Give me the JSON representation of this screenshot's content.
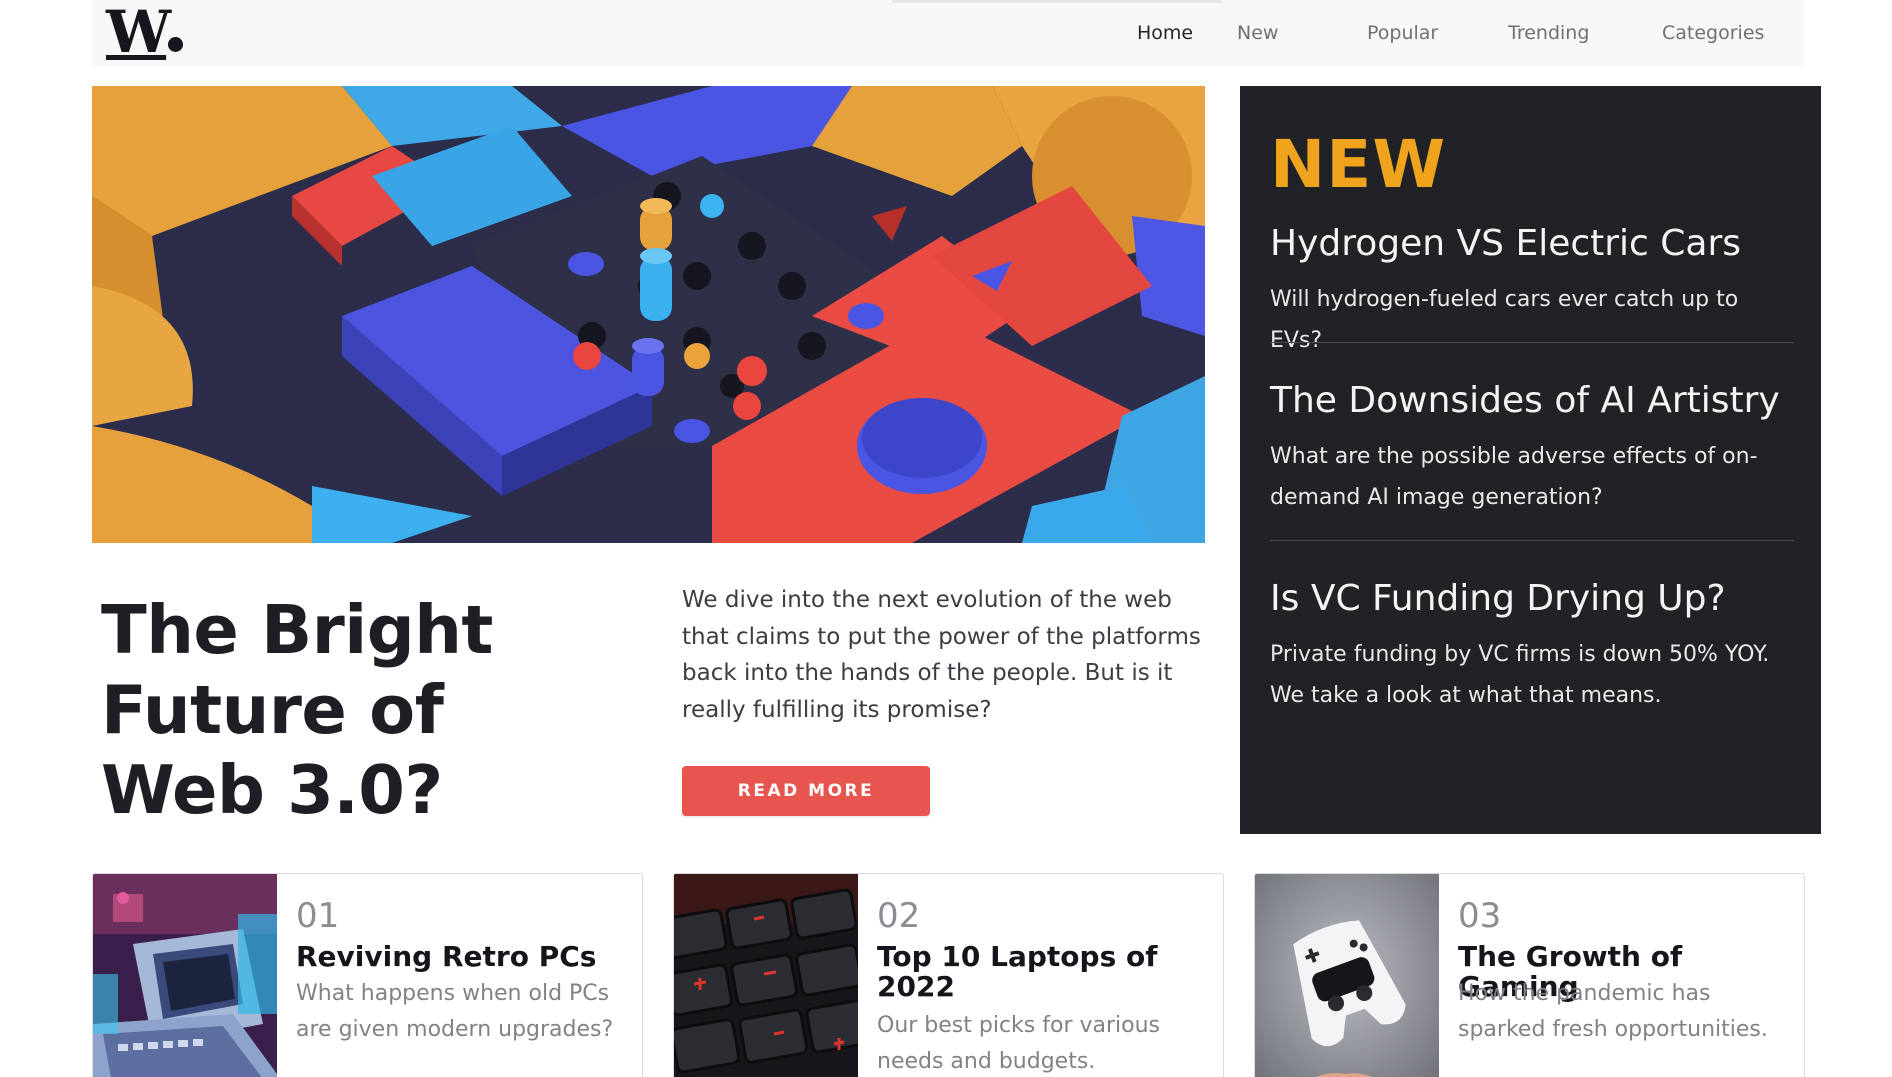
{
  "header": {
    "logo": "W",
    "nav": [
      "Home",
      "New",
      "Popular",
      "Trending",
      "Categories"
    ]
  },
  "hero": {
    "title": "The Bright Future of Web 3.0?",
    "description": "We dive into the next evolution of the web that claims to put the power of the platforms back into the hands of the people. But is it really fulfilling its promise?",
    "read_more_label": "READ MORE"
  },
  "new_panel": {
    "heading": "NEW",
    "items": [
      {
        "title": "Hydrogen VS Electric Cars",
        "desc": "Will hydrogen-fueled cars ever catch up to EVs?"
      },
      {
        "title": "The Downsides of AI Artistry",
        "desc": "What are the possible adverse effects of on-demand AI image generation?"
      },
      {
        "title": "Is VC Funding Drying Up?",
        "desc": "Private funding by VC firms is down 50% YOY. We take a look at what that means."
      }
    ]
  },
  "cards": [
    {
      "number": "01",
      "title": "Reviving Retro PCs",
      "desc": "What happens when old PCs are given modern upgrades?"
    },
    {
      "number": "02",
      "title": "Top 10 Laptops of 2022",
      "desc": "Our best picks for various needs and budgets."
    },
    {
      "number": "03",
      "title": "The Growth of Gaming",
      "desc": "How the pandemic has sparked fresh opportunities."
    }
  ],
  "colors": {
    "accent": "#e8554e",
    "new_heading": "#f0a31d",
    "panel_bg": "#202226",
    "header_bg": "#f8f8f9"
  },
  "icons": [
    "logo-mark"
  ]
}
